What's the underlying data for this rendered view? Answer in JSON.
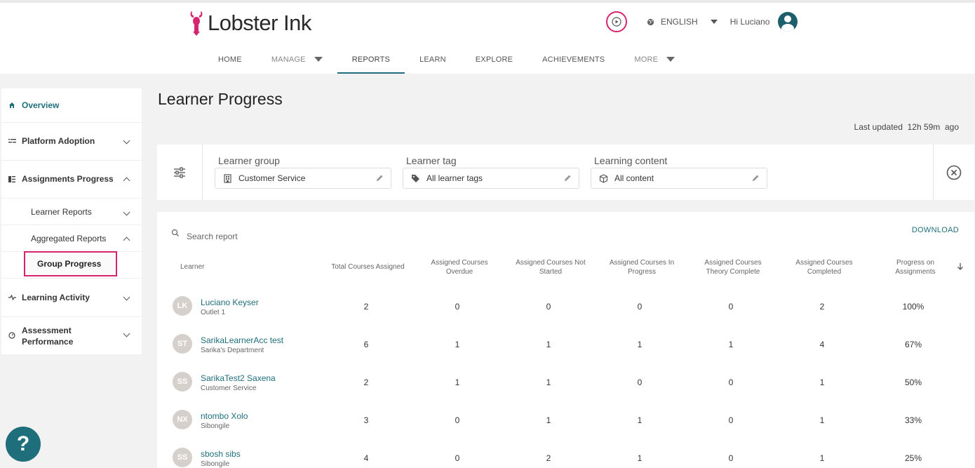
{
  "brand": {
    "name": "Lobster Ink",
    "accent": "#d6246e",
    "teal": "#1f6e7c"
  },
  "header": {
    "language": "ENGLISH",
    "greeting": "Hi Luciano"
  },
  "nav": [
    {
      "label": "HOME"
    },
    {
      "label": "MANAGE"
    },
    {
      "label": "REPORTS"
    },
    {
      "label": "LEARN"
    },
    {
      "label": "EXPLORE"
    },
    {
      "label": "ACHIEVEMENTS"
    },
    {
      "label": "MORE"
    }
  ],
  "sidebar": {
    "overview": "Overview",
    "platform_adoption": "Platform Adoption",
    "assignments_progress": "Assignments Progress",
    "learner_reports": "Learner Reports",
    "aggregated_reports": "Aggregated Reports",
    "group_progress": "Group Progress",
    "learning_activity": "Learning Activity",
    "assessment_performance_1": "Assessment",
    "assessment_performance_2": "Performance"
  },
  "page": {
    "title": "Learner Progress",
    "last_updated_label": "Last updated",
    "last_updated_value": "12h 59m",
    "last_updated_suffix": "ago"
  },
  "filters": {
    "learner_group": {
      "label": "Learner group",
      "value": "Customer Service"
    },
    "learner_tag": {
      "label": "Learner tag",
      "value": "All learner tags"
    },
    "learning_content": {
      "label": "Learning content",
      "value": "All content"
    }
  },
  "report": {
    "search_placeholder": "Search report",
    "download": "DOWNLOAD",
    "columns": {
      "learner": "Learner",
      "total": "Total Courses Assigned",
      "overdue_1": "Assigned Courses",
      "overdue_2": "Overdue",
      "not_started_1": "Assigned Courses Not",
      "not_started_2": "Started",
      "in_progress_1": "Assigned Courses In",
      "in_progress_2": "Progress",
      "theory_1": "Assigned Courses",
      "theory_2": "Theory Complete",
      "completed_1": "Assigned Courses",
      "completed_2": "Completed",
      "progress_1": "Progress on",
      "progress_2": "Assignments"
    },
    "rows": [
      {
        "initials": "LK",
        "name": "Luciano Keyser",
        "dept": "Outlet 1",
        "total": "2",
        "overdue": "0",
        "not_started": "0",
        "in_progress": "0",
        "theory": "0",
        "completed": "2",
        "progress": "100%"
      },
      {
        "initials": "ST",
        "name": "SarikaLearnerAcc test",
        "dept": "Sarika's Department",
        "total": "6",
        "overdue": "1",
        "not_started": "1",
        "in_progress": "1",
        "theory": "1",
        "completed": "4",
        "progress": "67%"
      },
      {
        "initials": "SS",
        "name": "SarikaTest2 Saxena",
        "dept": "Customer Service",
        "total": "2",
        "overdue": "1",
        "not_started": "1",
        "in_progress": "0",
        "theory": "0",
        "completed": "1",
        "progress": "50%"
      },
      {
        "initials": "NX",
        "name": "ntombo Xolo",
        "dept": "Sibongile",
        "total": "3",
        "overdue": "0",
        "not_started": "1",
        "in_progress": "1",
        "theory": "0",
        "completed": "1",
        "progress": "33%"
      },
      {
        "initials": "SS",
        "name": "sbosh sibs",
        "dept": "Sibongile",
        "total": "4",
        "overdue": "0",
        "not_started": "2",
        "in_progress": "1",
        "theory": "0",
        "completed": "1",
        "progress": "25%"
      }
    ]
  },
  "help": {
    "label": "?"
  }
}
